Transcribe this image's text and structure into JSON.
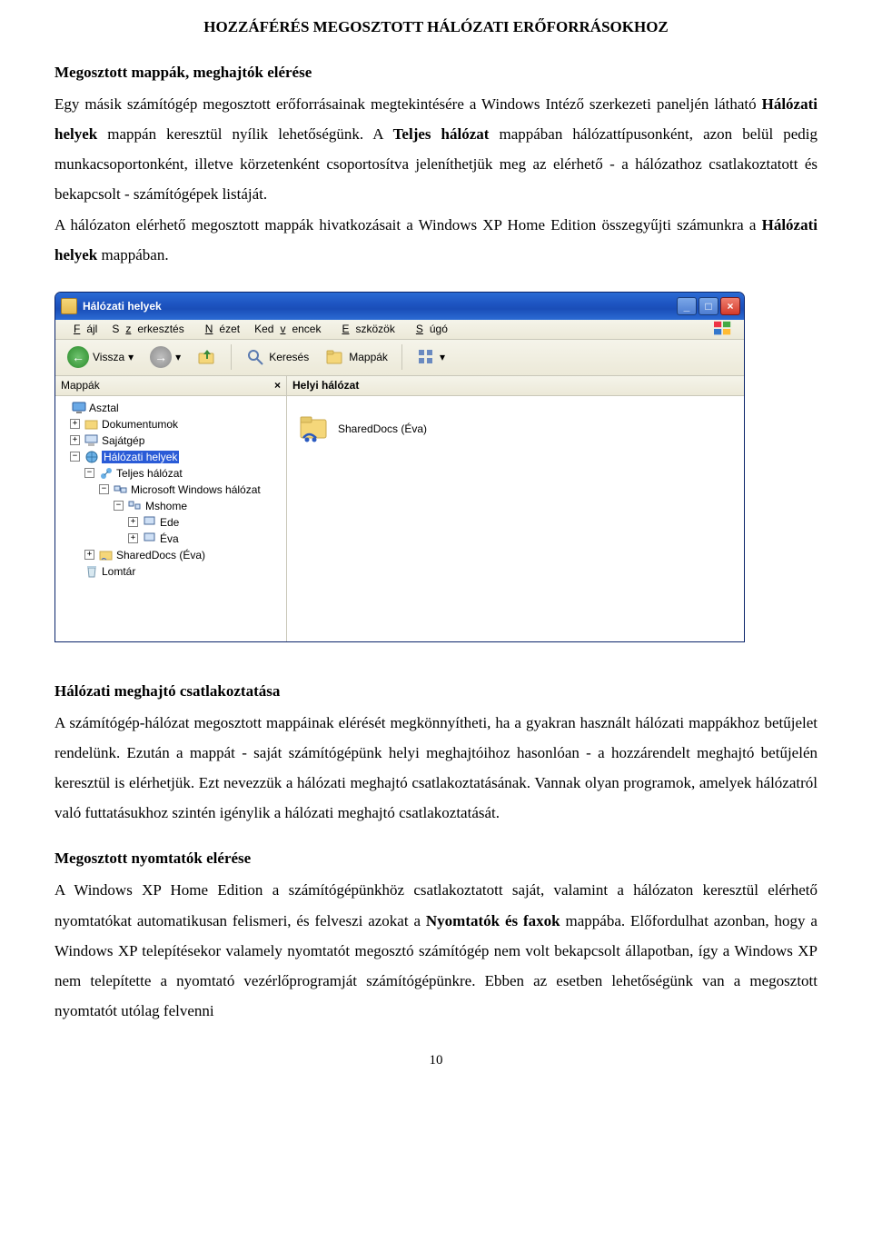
{
  "doc": {
    "title": "HOZZÁFÉRÉS MEGOSZTOTT HÁLÓZATI ERŐFORRÁSOKHOZ",
    "h1": "Megosztott mappák, meghajtók elérése",
    "p1a": "Egy másik számítógép megosztott erőforrásainak megtekintésére a Windows Intéző szerkezeti paneljén látható ",
    "p1b": "Hálózati helyek",
    "p1c": " mappán keresztül nyílik lehetőségünk. A ",
    "p1d": "Teljes hálózat",
    "p1e": " mappában hálózattípusonként, azon belül pedig munkacsoportonként, illetve körzetenként csoportosítva jeleníthetjük meg az elérhető - a hálózathoz csatlakoztatott és bekapcsolt - számítógépek listáját.",
    "p2a": "A hálózaton elérhető megosztott mappák hivatkozásait a Windows XP Home Edition összegyűjti számunkra a ",
    "p2b": "Hálózati helyek",
    "p2c": " mappában.",
    "h2": "Hálózati meghajtó csatlakoztatása",
    "p3": "A számítógép-hálózat megosztott mappáinak elérését megkönnyítheti, ha a gyakran használt hálózati mappákhoz betűjelet rendelünk. Ezután a mappát - saját számítógépünk helyi meghajtóihoz hasonlóan - a hozzárendelt meghajtó betűjelén keresztül is elérhetjük. Ezt nevezzük a hálózati meghajtó csatlakoztatásának. Vannak olyan programok, amelyek hálózatról való futtatásukhoz szintén igénylik a hálózati meghajtó csatlakoztatását.",
    "h3": "Megosztott nyomtatók elérése",
    "p4a": "A Windows XP Home Edition a számítógépünkhöz csatlakoztatott saját, valamint a hálózaton keresztül elérhető nyomtatókat automatikusan felismeri, és felveszi azokat a ",
    "p4b": "Nyomtatók és faxok",
    "p4c": " mappába. Előfordulhat azonban, hogy a Windows XP telepítésekor valamely nyomtatót megosztó számítógép nem volt bekapcsolt állapotban, így a Windows XP nem telepítette a nyomtató vezérlőprogramját számítógépünkre. Ebben az esetben lehetőségünk van a megosztott nyomtatót utólag felvenni",
    "page": "10"
  },
  "win": {
    "title": "Hálózati helyek",
    "menu": {
      "file": "Fájl",
      "edit": "Szerkesztés",
      "view": "Nézet",
      "fav": "Kedvencek",
      "tools": "Eszközök",
      "help": "Súgó"
    },
    "toolbar": {
      "back": "Vissza",
      "search": "Keresés",
      "folders": "Mappák"
    },
    "leftheader": "Mappák",
    "rightheader": "Helyi hálózat",
    "tree": {
      "desktop": "Asztal",
      "docs": "Dokumentumok",
      "mycomp": "Sajátgép",
      "netplaces": "Hálózati helyek",
      "fullnet": "Teljes hálózat",
      "msnet": "Microsoft Windows hálózat",
      "mshome": "Mshome",
      "ede": "Ede",
      "eva": "Éva",
      "shareddocs": "SharedDocs (Éva)",
      "trash": "Lomtár"
    },
    "item": "SharedDocs (Éva)"
  }
}
